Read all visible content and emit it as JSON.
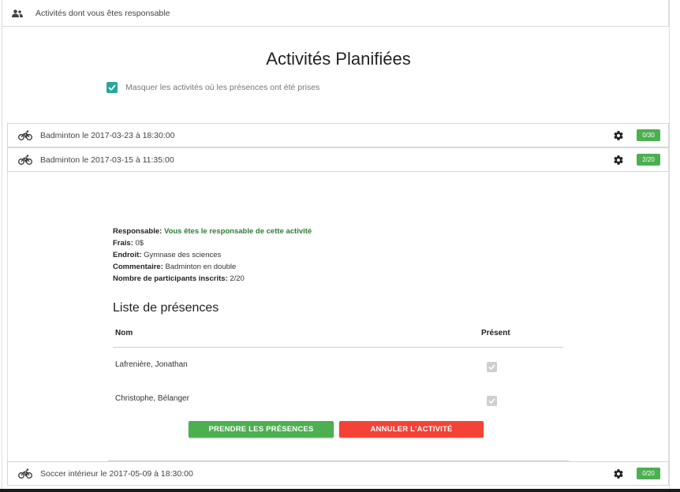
{
  "header": {
    "label": "Activités dont vous êtes responsable",
    "icon": "people-icon"
  },
  "page": {
    "title": "Activités Planifiées",
    "hide_label": "Masquer les activités où les présences ont été prises",
    "hide_checked": true,
    "accent_color": "#26a69a"
  },
  "activities": [
    {
      "title": "Badminton le 2017-03-23 à 18:30:00",
      "badge": "0/30"
    },
    {
      "title": "Badminton le 2017-03-15 à 11:35:00",
      "badge": "2/20"
    },
    {
      "title": "Soccer intérieur le 2017-05-09 à 18:30:00",
      "badge": "0/20"
    }
  ],
  "detail": {
    "responsable_label": "Responsable:",
    "responsable_value": "Vous êtes le responsable de cette activité",
    "frais_label": "Frais:",
    "frais_value": "0$",
    "endroit_label": "Endroit:",
    "endroit_value": "Gymnase des sciences",
    "commentaire_label": "Commentaire:",
    "commentaire_value": "Badminton en double",
    "inscrits_label": "Nombre de participants inscrits:",
    "inscrits_value": "2/20",
    "list_title": "Liste de présences",
    "col_name": "Nom",
    "col_present": "Présent",
    "participants": [
      {
        "name": "Lafrenière, Jonathan",
        "present": true
      },
      {
        "name": "Christophe, Bélanger",
        "present": true
      }
    ],
    "btn_take": "PRENDRE LES PRÉSENCES",
    "btn_cancel": "ANNULER L'ACTIVITÉ"
  },
  "colors": {
    "badge": "#4caf50",
    "take_button": "#4caf50",
    "cancel_button": "#f44336",
    "responsable_text": "#2e7d32"
  }
}
